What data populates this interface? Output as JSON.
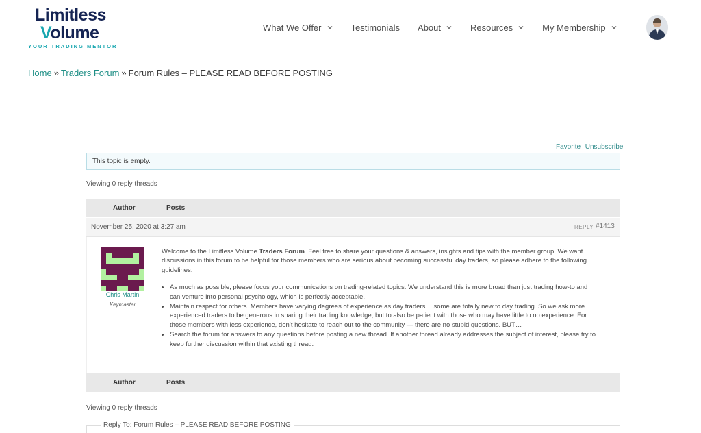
{
  "logo": {
    "line1": "Limitless",
    "line2_v": "V",
    "line2_rest": "olume",
    "tagline": "YOUR TRADING MENTOR"
  },
  "nav": [
    {
      "label": "What We Offer",
      "dropdown": true
    },
    {
      "label": "Testimonials",
      "dropdown": false
    },
    {
      "label": "About",
      "dropdown": true
    },
    {
      "label": "Resources",
      "dropdown": true
    },
    {
      "label": "My Membership",
      "dropdown": true
    }
  ],
  "breadcrumb": {
    "home": "Home",
    "forum": "Traders Forum",
    "separator": "»",
    "current": "Forum Rules – PLEASE READ BEFORE POSTING"
  },
  "topic": {
    "favorite": "Favorite",
    "unsubscribe": "Unsubscribe",
    "notice": "This topic is empty.",
    "viewing": "Viewing 0 reply threads",
    "col_author": "Author",
    "col_posts": "Posts"
  },
  "post": {
    "date": "November 25, 2020 at 3:27 am",
    "reply": "REPLY",
    "id": "#1413",
    "author": "Chris Martin",
    "role": "Keymaster",
    "intro_before": "Welcome to the Limitless Volume ",
    "intro_bold": "Traders Forum",
    "intro_after": ". Feel free to share your questions & answers, insights and tips with the member group.  We want discussions in this forum to be helpful for those members who are serious about becoming successful day traders, so please adhere to the following guidelines:",
    "bullets": [
      "As much as possible, please focus your communications on trading-related topics. We understand this is more broad than just trading how-to and can venture into personal psychology, which is perfectly acceptable.",
      "Maintain respect for others. Members have varying degrees of experience as day traders… some are totally new to day trading. So we ask more experienced traders to be generous in sharing their trading knowledge, but to also be patient with those who may have little to no experience. For those members with less experience, don’t hesitate to reach out to the community — there are no stupid questions. BUT…",
      "Search the forum for answers to any questions before posting a new thread. If another thread already addresses the subject of interest, please try to keep further discussion within that existing thread."
    ]
  },
  "reply_box": {
    "legend": "Reply To: Forum Rules – PLEASE READ BEFORE POSTING"
  },
  "colors": {
    "brand_navy": "#152453",
    "brand_teal": "#1aa7b0",
    "link": "#1f8f86",
    "avatar_bg": "#b2f0a0",
    "avatar_fg": "#6b1a4e"
  }
}
